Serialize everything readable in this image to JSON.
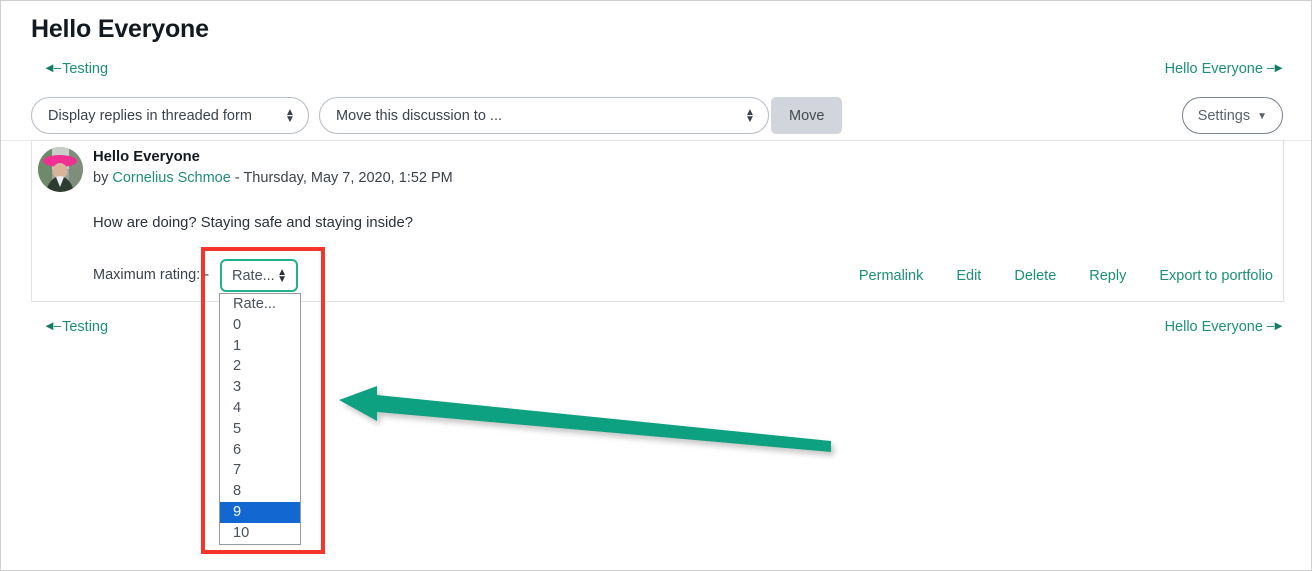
{
  "page": {
    "title": "Hello Everyone"
  },
  "nav_top": {
    "prev_label": "Testing",
    "prev_icon": "arrow-left-icon",
    "next_label": "Hello Everyone",
    "next_icon": "arrow-right-icon"
  },
  "nav_bottom": {
    "prev_label": "Testing",
    "prev_icon": "arrow-left-icon",
    "next_label": "Hello Everyone",
    "next_icon": "arrow-right-icon"
  },
  "toolbar": {
    "display_mode_value": "Display replies in threaded form",
    "display_mode_options": [
      "Display replies in threaded form"
    ],
    "move_discussion_value": "Move this discussion to ...",
    "move_discussion_options": [
      "Move this discussion to ..."
    ],
    "move_button_label": "Move",
    "settings_label": "Settings",
    "settings_icon": "chevron-down-icon"
  },
  "post": {
    "avatar_icon": "user-avatar",
    "subject": "Hello Everyone",
    "byline_prefix": "by ",
    "author": "Cornelius Schmoe",
    "byline_separator": " - ",
    "timestamp": "Thursday, May 7, 2020, 1:52 PM",
    "body": "How are doing? Staying safe and staying inside?",
    "rating_label": "Maximum rating: -",
    "links": [
      "Permalink",
      "Edit",
      "Delete",
      "Reply",
      "Export to portfolio"
    ]
  },
  "rating_select": {
    "value": "Rate...",
    "caret_icon": "updown-caret-icon",
    "options": [
      "Rate...",
      "0",
      "1",
      "2",
      "3",
      "4",
      "5",
      "6",
      "7",
      "8",
      "9",
      "10"
    ],
    "highlighted_option": "9"
  },
  "annotations": {
    "highlight_box_color": "#f5352b",
    "arrow_color": "#16a085",
    "arrow_icon": "arrow-left-annotation"
  },
  "colors": {
    "link": "#1d8f78",
    "focus_ring": "#22b18c",
    "selected_option": "#1367d1",
    "move_button_bg": "#d2d6dc"
  }
}
